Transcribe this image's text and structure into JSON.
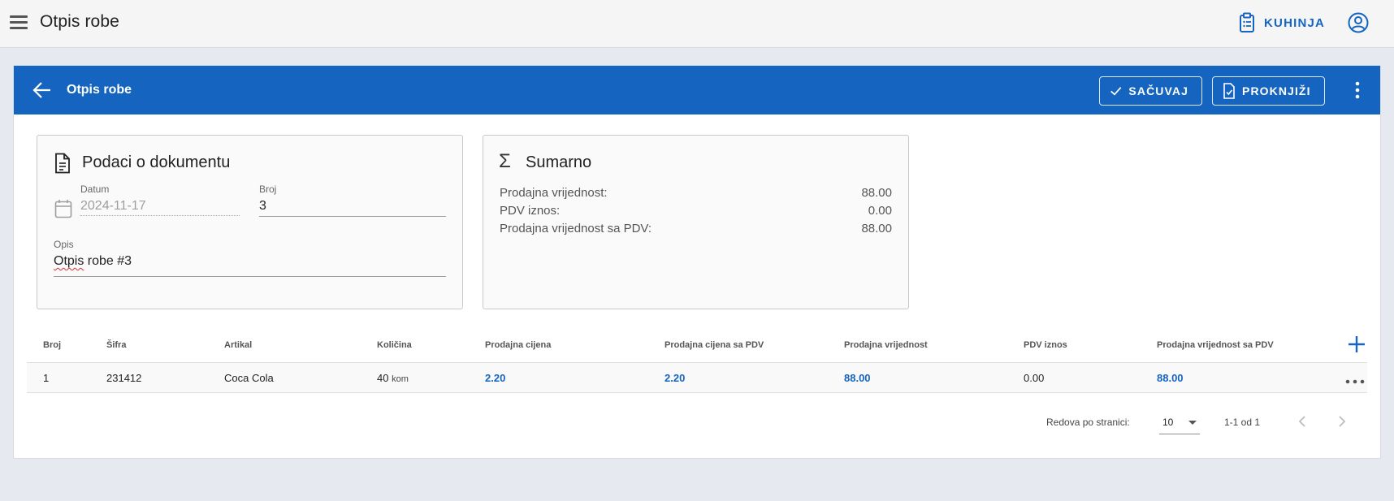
{
  "app": {
    "title": "Otpis robe",
    "kitchen_label": "KUHINJA"
  },
  "toolbar": {
    "title": "Otpis robe",
    "save_label": "SAČUVAJ",
    "post_label": "PROKNJIŽI"
  },
  "document": {
    "title": "Podaci o dokumentu",
    "date_label": "Datum",
    "date_value": "2024-11-17",
    "number_label": "Broj",
    "number_value": "3",
    "description_label": "Opis",
    "description_word1": "Otpis",
    "description_rest": " robe #3"
  },
  "summary": {
    "title": "Sumarno",
    "rows": [
      {
        "label": "Prodajna vrijednost:",
        "value": "88.00"
      },
      {
        "label": "PDV iznos:",
        "value": "0.00"
      },
      {
        "label": "Prodajna vrijednost sa PDV:",
        "value": "88.00"
      }
    ]
  },
  "table": {
    "headers": [
      "Broj",
      "Šifra",
      "Artikal",
      "Količina",
      "Prodajna cijena",
      "Prodajna cijena sa PDV",
      "Prodajna vrijednost",
      "PDV iznos",
      "Prodajna vrijednost sa PDV"
    ],
    "rows": [
      {
        "broj": "1",
        "sifra": "231412",
        "artikal": "Coca Cola",
        "kolicina": "40",
        "unit": "kom",
        "prodajna_cijena": "2.20",
        "prodajna_cijena_pdv": "2.20",
        "prodajna_vrijednost": "88.00",
        "pdv_iznos": "0.00",
        "prodajna_vrijednost_pdv": "88.00"
      }
    ]
  },
  "pagination": {
    "rows_per_page_label": "Redova po stranici:",
    "rows_per_page_value": "10",
    "range": "1-1 od 1"
  },
  "colors": {
    "primary": "#1565c0",
    "app_bar": "#f5f5f5",
    "background": "#e6e9f0"
  }
}
